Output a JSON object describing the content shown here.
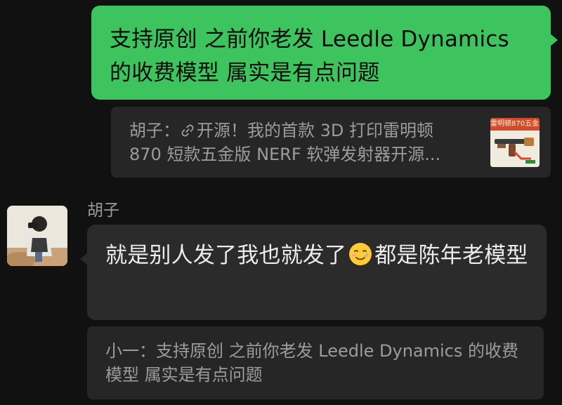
{
  "messages": {
    "outgoing": {
      "text": "支持原创 之前你老发 Leedle Dynamics 的收费模型 属实是有点问题",
      "bubble_color": "#3ec45f"
    },
    "quoted_link": {
      "sender_prefix": "胡子：",
      "icon": "link-icon",
      "line1_text": "开源！我的首款 3D 打印雷明顿",
      "line2_text": "870 短款五金版 NERF 软弹发射器开源...",
      "thumbnail_caption": "雷明顿870五金版"
    },
    "incoming": {
      "sender_name": "胡子",
      "avatar": "avatar",
      "text_before_emoji": "就是别人发了我也就发了",
      "emoji": "smiling-face-with-tear-emoji",
      "text_after_emoji": "都是陈年老模型",
      "bubble_color": "#2b2b2b"
    },
    "quoted_reply": {
      "text": "小一：支持原创 之前你老发 Leedle Dynamics 的收费模型 属实是有点问题"
    }
  }
}
